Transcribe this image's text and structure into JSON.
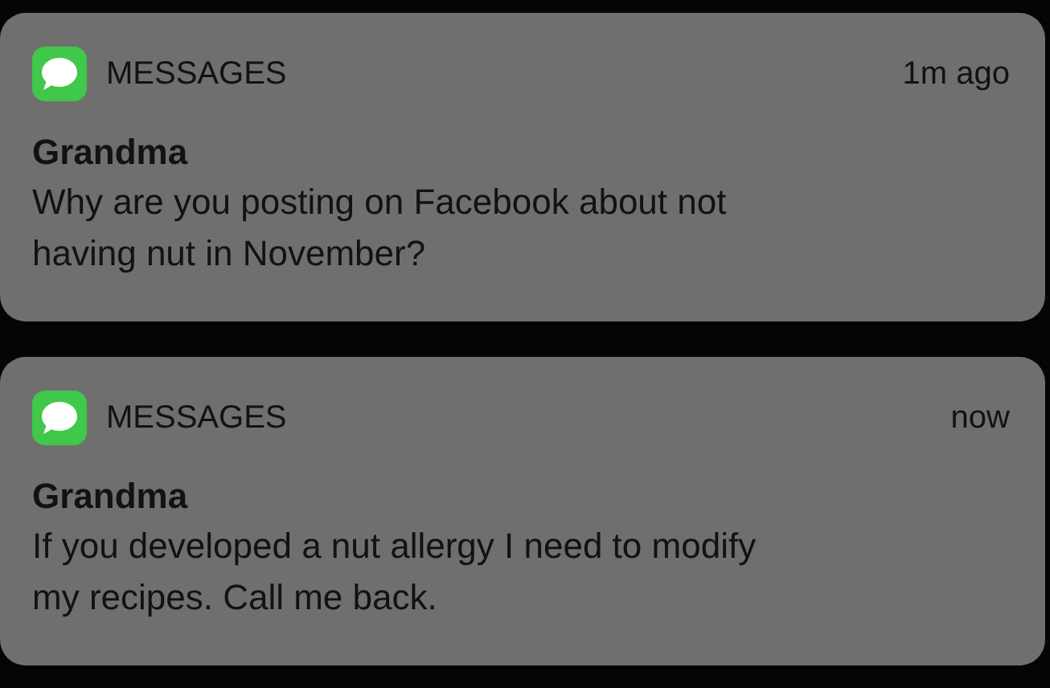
{
  "notifications": [
    {
      "app": "MESSAGES",
      "time": "1m ago",
      "title": "Grandma",
      "body_lines": [
        "Why are you posting on Facebook about not",
        "having nut in November?"
      ]
    },
    {
      "app": "MESSAGES",
      "time": "now",
      "title": "Grandma",
      "body_lines": [
        "If you developed a nut allergy I need to modify",
        "my recipes. Call me back."
      ]
    }
  ]
}
